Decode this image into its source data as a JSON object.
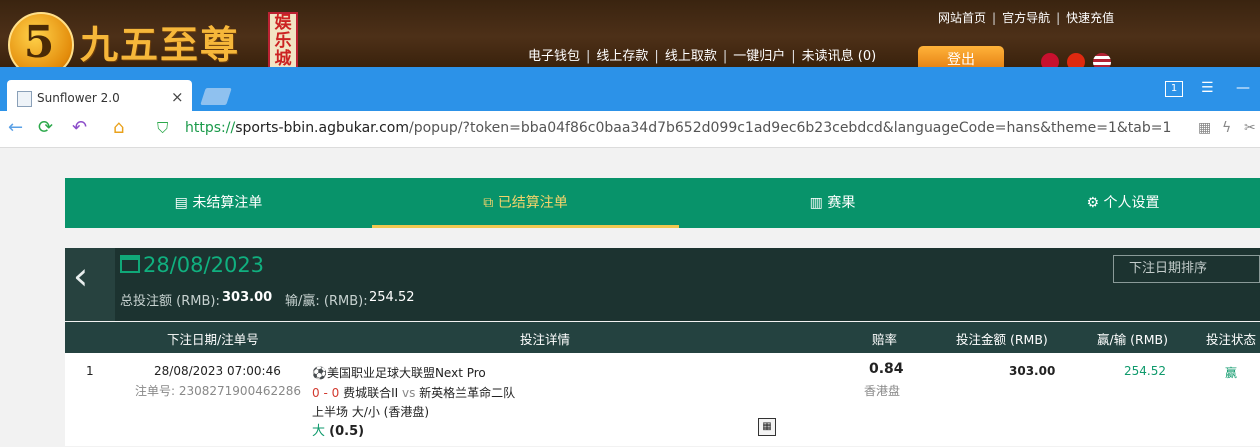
{
  "site": {
    "logo_digit": "5",
    "logo_name": "九五至尊",
    "logo_sub": "娱乐城",
    "top_links": [
      "网站首页",
      "官方导航",
      "快速充值"
    ],
    "nav_links": [
      "电子钱包",
      "线上存款",
      "线上取款",
      "一键归户",
      "未读讯息 (0)"
    ],
    "logout": "登出"
  },
  "browser": {
    "tab_title": "Sunflower 2.0",
    "url_scheme": "https://",
    "url_host": "sports-bbin.agbukar.com",
    "url_rest": "/popup/?token=bba04f86c0baa34d7b652d099c1ad9ec6b23cebdcd&languageCode=hans&theme=1&tab=1",
    "tab_badge": "1"
  },
  "app_tabs": [
    {
      "label": "未结算注单",
      "icon": "receipt-icon"
    },
    {
      "label": "已结算注单",
      "icon": "settled-icon",
      "active": true
    },
    {
      "label": "赛果",
      "icon": "results-icon"
    },
    {
      "label": "个人设置",
      "icon": "gear-icon"
    }
  ],
  "summary": {
    "date": "28/08/2023",
    "total_label": "总投注额 (RMB):",
    "total_value": "303.00",
    "win_label": "输/赢: (RMB):",
    "win_value": "254.52",
    "sort_placeholder": "下注日期排序"
  },
  "table": {
    "headers": {
      "date": "下注日期/注单号",
      "detail": "投注详情",
      "odds": "赔率",
      "amount": "投注金额 (RMB)",
      "winloss": "赢/输 (RMB)",
      "status": "投注状态"
    },
    "rows": [
      {
        "index": "1",
        "datetime": "28/08/2023 07:00:46",
        "bet_no": "注单号: 2308271900462286",
        "league": "美国职业足球大联盟Next Pro",
        "score": "0 - 0",
        "home": "费城联合II",
        "vs": "vs",
        "away": "新英格兰革命二队",
        "market": "上半场 大/小 (香港盘)",
        "pick": "大",
        "line": "(0.5)",
        "odds": "0.84",
        "odds_type": "香港盘",
        "amount": "303.00",
        "winloss": "254.52",
        "status": "赢"
      }
    ]
  },
  "colors": {
    "nav_green": "#08936a",
    "dark_panel": "#1c3330",
    "accent_gold": "#f0c850",
    "win_green": "#0f9a6c",
    "score_red": "#d23a2f",
    "browser_blue": "#2c92e8"
  }
}
